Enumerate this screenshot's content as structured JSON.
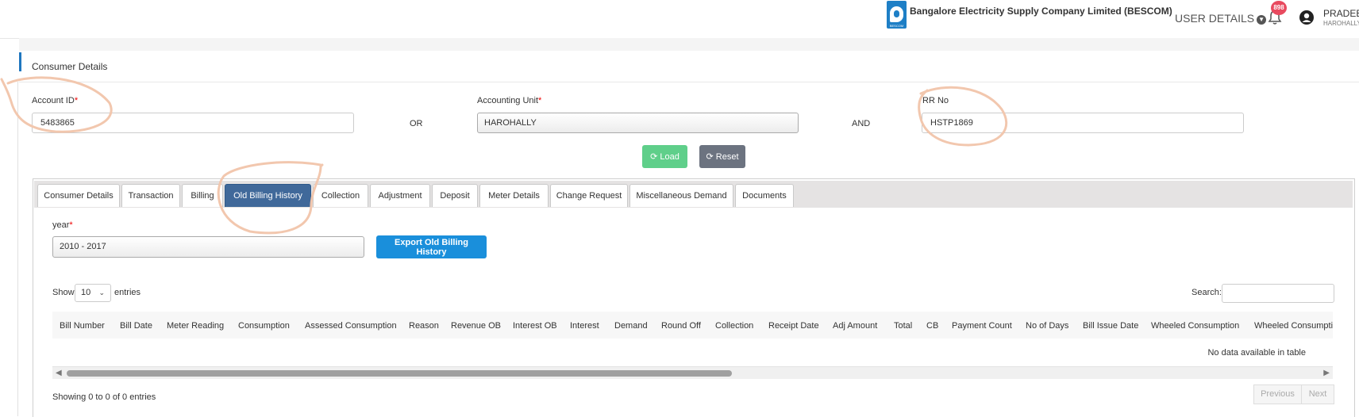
{
  "header": {
    "company_name": "Bangalore Electricity Supply Company Limited (BESCOM)",
    "logo_text": "BESCOM",
    "user_details_label": "USER DETAILS",
    "notification_count": "898",
    "user_name": "PRADEEP",
    "user_location": "HAROHALLY"
  },
  "section": {
    "title": "Consumer Details"
  },
  "form": {
    "account_id_label": "Account ID",
    "account_id_value": "5483865",
    "or_label": "OR",
    "accounting_unit_label": "Accounting Unit",
    "accounting_unit_value": "HAROHALLY",
    "and_label": "AND",
    "rr_no_label": "RR No",
    "rr_no_value": "HSTP1869",
    "required_mark": "*",
    "load_label": "Load",
    "reset_label": "Reset"
  },
  "tabs": [
    "Consumer Details",
    "Transaction",
    "Billing",
    "Old Billing History",
    "Collection",
    "Adjustment",
    "Deposit",
    "Meter Details",
    "Change Request",
    "Miscellaneous Demand",
    "Documents"
  ],
  "active_tab": "Old Billing History",
  "history": {
    "year_label": "year",
    "year_value": "2010 - 2017",
    "export_label": "Export Old Billing History",
    "show_label": "Show",
    "entries_value": "10",
    "entries_label": "entries",
    "search_label": "Search:",
    "columns": [
      "Bill Number",
      "Bill Date",
      "Meter Reading",
      "Consumption",
      "Assessed Consumption",
      "Reason",
      "Revenue OB",
      "Interest OB",
      "Interest",
      "Demand",
      "Round Off",
      "Collection",
      "Receipt Date",
      "Adj Amount",
      "Total",
      "CB",
      "Payment Count",
      "No of Days",
      "Bill Issue Date",
      "Wheeled Consumption",
      "Wheeled Consumpti"
    ],
    "empty_message": "No data available in table",
    "info_text": "Showing 0 to 0 of 0 entries",
    "previous_label": "Previous",
    "next_label": "Next"
  },
  "colors": {
    "accent_blue": "#1f77bf",
    "active_tab": "#40699a",
    "load_button": "#5fcf8a",
    "reset_button": "#6c7380",
    "export_button": "#1a8fdb",
    "badge": "#e84a5f",
    "annotation": "#f2c7ae"
  }
}
